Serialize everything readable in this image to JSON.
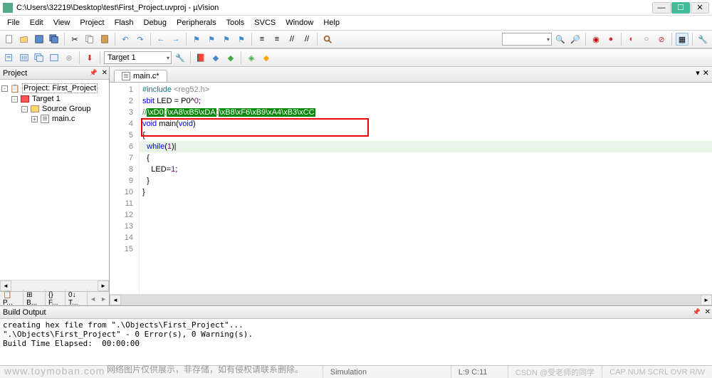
{
  "title": "C:\\Users\\32219\\Desktop\\test\\First_Project.uvproj - µVision",
  "menu": [
    "File",
    "Edit",
    "View",
    "Project",
    "Flash",
    "Debug",
    "Peripherals",
    "Tools",
    "SVCS",
    "Window",
    "Help"
  ],
  "toolbar2_target": "Target 1",
  "project_panel": {
    "title": "Project",
    "root": "Project: First_Project",
    "target": "Target 1",
    "group": "Source Group",
    "file": "main.c",
    "tabs": [
      "📋 P...",
      "⊞ B...",
      "{} F...",
      "0↓ T..."
    ]
  },
  "editor": {
    "tab_name": "main.c*",
    "lines": [
      {
        "n": 1,
        "cls": "",
        "html": "<span class='kw-pp'>#include</span> <span class='kw-str'>&lt;reg52.h&gt;</span>"
      },
      {
        "n": 2,
        "cls": "",
        "html": ""
      },
      {
        "n": 3,
        "cls": "",
        "html": "<span class='kw-blue'>sbit</span> <span class='kw-id'>LED</span> <span class='kw-txt'>= P0^</span><span class='kw-num'>0</span><span class='kw-txt'>;</span>"
      },
      {
        "n": 4,
        "cls": "",
        "html": ""
      },
      {
        "n": 5,
        "cls": "",
        "html": "<span class='comment-slash'>//</span><span class='comment-bg'>\\xD0</span><span class='comment-slash'>;</span><span class='comment-bg'>\\xA8\\xB5\\xDA</span><span class='comment-slash'>;</span><span class='comment-bg'>\\xB8\\xF6\\xB9\\xA4\\xB3\\xCC</span>"
      },
      {
        "n": 6,
        "cls": "",
        "html": ""
      },
      {
        "n": 7,
        "cls": "",
        "html": "<span class='kw-blue'>void</span> <span class='kw-id'>main</span><span class='kw-txt'>(</span><span class='kw-blue'>void</span><span class='kw-txt'>)</span>"
      },
      {
        "n": 8,
        "cls": "",
        "html": "<span class='kw-txt'>{</span>"
      },
      {
        "n": 9,
        "cls": "hl",
        "html": "  <span class='kw-blue'>while</span><span class='kw-txt'>(</span><span class='kw-num'>1</span><span class='kw-txt'>)</span><span class='cursor-box'>|</span>"
      },
      {
        "n": 10,
        "cls": "",
        "html": "  <span class='kw-txt'>{</span>"
      },
      {
        "n": 11,
        "cls": "",
        "html": "    <span class='kw-id'>LED</span><span class='kw-txt'>=</span><span class='kw-num'>1</span><span class='kw-txt'>;</span>"
      },
      {
        "n": 12,
        "cls": "",
        "html": "  <span class='kw-txt'>}</span>"
      },
      {
        "n": 13,
        "cls": "",
        "html": "<span class='kw-txt'>}</span>"
      },
      {
        "n": 14,
        "cls": "",
        "html": ""
      },
      {
        "n": 15,
        "cls": "",
        "html": ""
      }
    ]
  },
  "build_output": {
    "title": "Build Output",
    "lines": [
      "creating hex file from \".\\Objects\\First_Project\"...",
      "\".\\Objects\\First_Project\" - 0 Error(s), 0 Warning(s).",
      "Build Time Elapsed:  00:00:00"
    ]
  },
  "statusbar": {
    "simulation": "Simulation",
    "cursor": "L:9 C:11",
    "indicators": "CAP NUM SCRL OVR R/W",
    "csdn": "CSDN @受老师的同学"
  },
  "watermark": "www.toymoban.com",
  "cn_desc": "网络图片仅供展示，非存储，如有侵权请联系删除。"
}
